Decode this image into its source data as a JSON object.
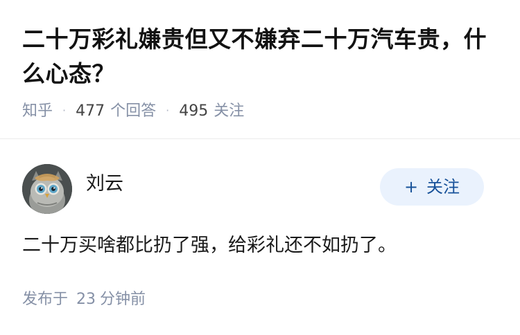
{
  "question": {
    "title": "二十万彩礼嫌贵但又不嫌弃二十万汽车贵，什么心态？",
    "source": "知乎",
    "answer_count": "477",
    "answer_count_label": "个回答",
    "follower_count": "495",
    "follower_count_label": "关注"
  },
  "answer": {
    "author_name": "刘云",
    "follow_plus": "+",
    "follow_label": "关注",
    "content": "二十万买啥都比扔了强，给彩礼还不如扔了。",
    "time_prefix": "发布于",
    "time_value": "23",
    "time_suffix": "分钟前"
  },
  "colors": {
    "meta_gray": "#8590a6",
    "follow_blue": "#175199",
    "follow_bg": "#eaf2fd"
  },
  "icons": {
    "avatar": "owl-avatar"
  }
}
